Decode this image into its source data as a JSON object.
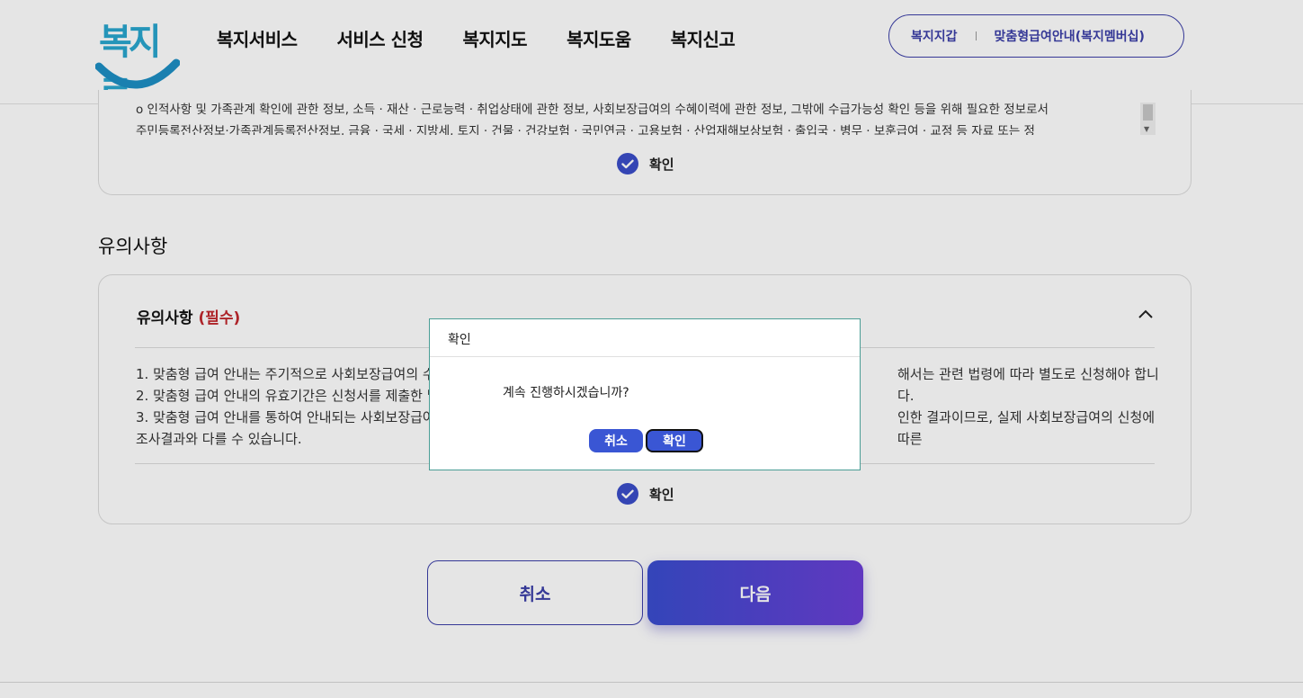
{
  "header": {
    "logo_text": "복지로",
    "nav": [
      "복지서비스",
      "서비스 신청",
      "복지지도",
      "복지도움",
      "복지신고"
    ],
    "util_links": [
      "복지지갑",
      "맞춤형급여안내(복지멤버십)"
    ]
  },
  "consent": {
    "lines": [
      "o 인적사항 및 가족관계 확인에 관한 정보, 소득 · 재산 · 근로능력 · 취업상태에 관한 정보, 사회보장급여의 수혜이력에 관한 정보, 그밖에 수급가능성 확인 등을 위해 필요한 정보로서",
      "주민등록전산정보·가족관계등록전산정보, 금융 · 국세 · 지방세, 토지 · 건물 · 건강보험 · 국민연금 · 고용보험 · 산업재해보상보험 · 출입국 · 병무 · 보훈급여 · 교정 등 자료 또는 정"
    ],
    "confirm_label": "확인"
  },
  "caution": {
    "section_title": "유의사항",
    "heading": "유의사항",
    "required": "(필수)",
    "items": [
      "1. 맞춤형 급여 안내는 주기적으로 사회보장급여의 수",
      "해서는 관련 법령에 따라 별도로 신청해야 합니다.",
      "2. 맞춤형 급여 안내의 유효기간은 신청서를 제출한 날",
      "3. 맞춤형 급여 안내를 통하여 안내되는 사회보장급여",
      "인한 결과이므로, 실제 사회보장급여의 신청에 따른",
      "조사결과와 다를 수 있습니다."
    ],
    "confirm_label": "확인"
  },
  "buttons": {
    "cancel": "취소",
    "next": "다음"
  },
  "dialog": {
    "title": "확인",
    "message": "계속 진행하시겠습니까?",
    "cancel": "취소",
    "ok": "확인"
  },
  "colors": {
    "accent": "#3a4dc9",
    "required": "#c1272d",
    "logo": "#2aa6cf"
  }
}
